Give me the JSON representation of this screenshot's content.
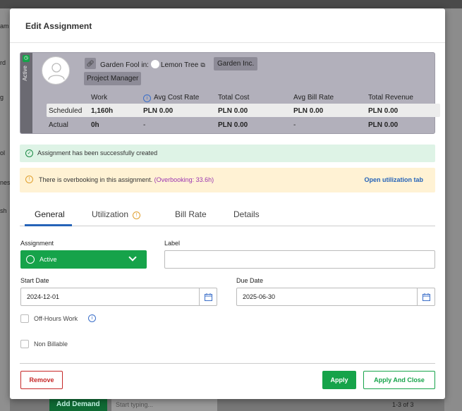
{
  "background": {
    "left_fragments": [
      "am",
      "rd",
      "g",
      "ol",
      "nes",
      "sh"
    ],
    "add_demand": "Add Demand",
    "search_placeholder": "Start typing...",
    "pagination": "1-3 of 3"
  },
  "modal": {
    "title": "Edit Assignment"
  },
  "summary": {
    "status_label": "Active",
    "name": "Garden Fool",
    "in_text": "in:",
    "project": "Lemon Tree",
    "client": "Garden Inc.",
    "role": "Project Manager",
    "columns": [
      "Work",
      "Avg Cost Rate",
      "Total Cost",
      "Avg Bill Rate",
      "Total Revenue"
    ],
    "rows": [
      {
        "label": "Scheduled",
        "work": "1,160h",
        "avg_cost_rate": "PLN 0.00",
        "total_cost": "PLN 0.00",
        "avg_bill_rate": "PLN 0.00",
        "total_revenue": "PLN 0.00"
      },
      {
        "label": "Actual",
        "work": "0h",
        "avg_cost_rate": "-",
        "total_cost": "PLN 0.00",
        "avg_bill_rate": "-",
        "total_revenue": "PLN 0.00"
      }
    ]
  },
  "alerts": {
    "success": "Assignment has been successfully created",
    "warning": "There is overbooking in this assignment.",
    "overbooking": "(Overbooking: 33.6h)",
    "open_util": "Open utilization tab"
  },
  "tabs": [
    "General",
    "Utilization",
    "Bill Rate",
    "Details"
  ],
  "form": {
    "assignment_label": "Assignment",
    "assignment_value": "Active",
    "label_label": "Label",
    "label_value": "",
    "start_date_label": "Start Date",
    "start_date_value": "2024-12-01",
    "due_date_label": "Due Date",
    "due_date_value": "2025-06-30",
    "off_hours_label": "Off-Hours Work",
    "non_billable_label": "Non Billable"
  },
  "buttons": {
    "remove": "Remove",
    "apply": "Apply",
    "apply_close": "Apply And Close"
  },
  "colors": {
    "success": "#16a34a",
    "danger": "#c62828",
    "link": "#2563b8",
    "overbooking": "#9b35b0"
  }
}
